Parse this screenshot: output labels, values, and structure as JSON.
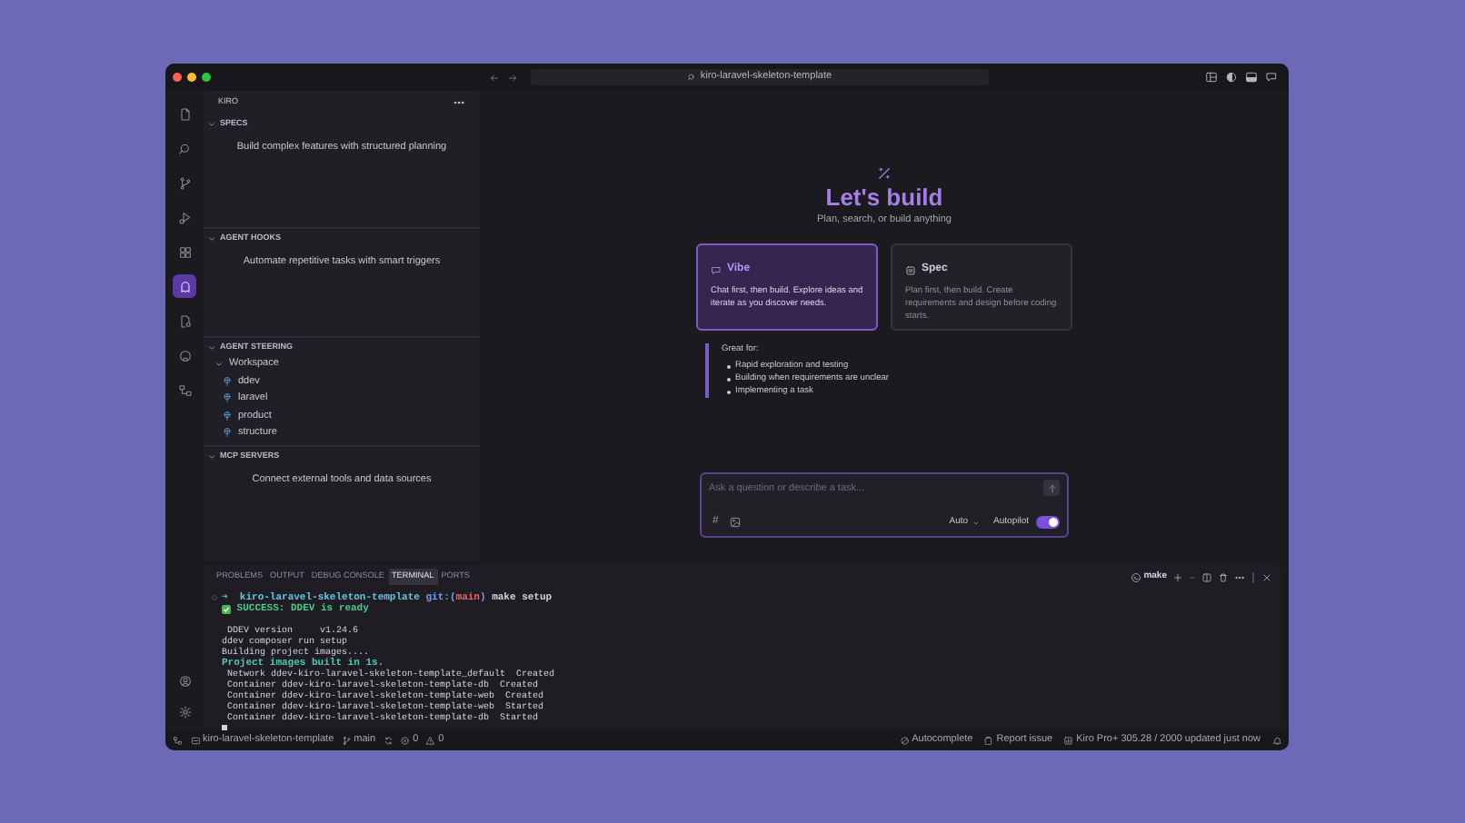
{
  "window": {
    "title": "kiro-laravel-skeleton-template"
  },
  "activity_bar": {
    "top": [
      {
        "kind": "files",
        "selected": false
      },
      {
        "kind": "search",
        "selected": false
      },
      {
        "kind": "branch",
        "selected": false
      },
      {
        "kind": "run",
        "selected": false
      },
      {
        "kind": "extensions",
        "selected": false
      },
      {
        "kind": "ghost",
        "selected": true
      },
      {
        "kind": "document",
        "selected": false
      },
      {
        "kind": "cat",
        "selected": false
      },
      {
        "kind": "remote",
        "selected": false
      }
    ],
    "bottom": [
      {
        "kind": "account"
      },
      {
        "kind": "settings"
      }
    ]
  },
  "sidebar": {
    "title": "KIRO",
    "sections": [
      {
        "title": "SPECS",
        "expanded": true,
        "description": "Build complex features with structured planning"
      },
      {
        "title": "AGENT HOOKS",
        "expanded": true,
        "description": "Automate repetitive tasks with smart triggers"
      },
      {
        "title": "AGENT STEERING",
        "expanded": true,
        "tree": [
          {
            "label": "Workspace",
            "expanded": true,
            "children": [
              {
                "label": "ddev"
              },
              {
                "label": "laravel"
              },
              {
                "label": "product"
              },
              {
                "label": "structure"
              }
            ]
          }
        ]
      },
      {
        "title": "MCP SERVERS",
        "expanded": true,
        "description": "Connect external tools and data sources"
      }
    ]
  },
  "editor": {
    "heading": "Let's build",
    "subtitle": "Plan, search, or build anything",
    "modes": [
      {
        "kind": "chat",
        "title": "Vibe",
        "description": "Chat first, then build. Explore ideas and iterate as you discover needs.",
        "selected": true
      },
      {
        "kind": "spec",
        "title": "Spec",
        "description": "Plan first, then build. Create requirements and design before coding starts.",
        "selected": false
      }
    ],
    "details": {
      "heading": "Great for:",
      "items": [
        "Rapid exploration and testing",
        "Building when requirements are unclear",
        "Implementing a task"
      ]
    },
    "chat": {
      "placeholder": "Ask a question or describe a task...",
      "hash": "#",
      "model": "Auto",
      "autopilot": {
        "label": "Autopilot",
        "on": true
      }
    }
  },
  "panel": {
    "tabs": [
      {
        "label": "PROBLEMS",
        "selected": false
      },
      {
        "label": "OUTPUT",
        "selected": false
      },
      {
        "label": "DEBUG CONSOLE",
        "selected": false
      },
      {
        "label": "TERMINAL",
        "selected": true
      },
      {
        "label": "PORTS",
        "selected": false
      }
    ],
    "terminal_name": "make",
    "lines": [
      {
        "kind": "command",
        "segments": [
          {
            "kind": "text",
            "text": "➜  ",
            "color": "#4ec98a"
          },
          {
            "kind": "text",
            "text": "kiro-laravel-skeleton-template",
            "color": "#62c8e0"
          },
          {
            "kind": "text",
            "text": " git:(",
            "color": "#6f9ef8"
          },
          {
            "kind": "text",
            "text": "main",
            "color": "#e5656f"
          },
          {
            "kind": "text",
            "text": ")",
            "color": "#6f9ef8"
          },
          {
            "kind": "text",
            "text": " make setup",
            "color": "#d4d4d4"
          }
        ]
      },
      {
        "kind": "output",
        "segments": [
          {
            "kind": "check"
          },
          {
            "kind": "text",
            "text": " SUCCESS: DDEV is ready",
            "color": "#4ec98a"
          }
        ]
      },
      {
        "kind": "output",
        "spaced": true,
        "segments": [
          {
            "kind": "text",
            "text": " DDEV version     v1.24.6"
          }
        ]
      },
      {
        "kind": "output",
        "segments": [
          {
            "kind": "text",
            "text": "ddev composer run setup"
          }
        ]
      },
      {
        "kind": "output",
        "segments": [
          {
            "kind": "text",
            "text": "Building project images...."
          }
        ]
      },
      {
        "kind": "output",
        "segments": [
          {
            "kind": "text",
            "text": "Project images built in 1s.",
            "color": "#4fc9b8"
          }
        ]
      },
      {
        "kind": "output",
        "segments": [
          {
            "kind": "text",
            "text": " Network ddev-kiro-laravel-skeleton-template_default  Created"
          }
        ]
      },
      {
        "kind": "output",
        "segments": [
          {
            "kind": "text",
            "text": " Container ddev-kiro-laravel-skeleton-template-db  Created"
          }
        ]
      },
      {
        "kind": "output",
        "segments": [
          {
            "kind": "text",
            "text": " Container ddev-kiro-laravel-skeleton-template-web  Created"
          }
        ]
      },
      {
        "kind": "output",
        "segments": [
          {
            "kind": "text",
            "text": " Container ddev-kiro-laravel-skeleton-template-web  Started"
          }
        ]
      },
      {
        "kind": "output",
        "segments": [
          {
            "kind": "text",
            "text": " Container ddev-kiro-laravel-skeleton-template-db  Started"
          }
        ]
      },
      {
        "kind": "cursor"
      }
    ]
  },
  "status_bar": {
    "left": [
      {
        "kind": "remote"
      },
      {
        "kind": "folder",
        "text": "kiro-laravel-skeleton-template"
      },
      {
        "kind": "branch",
        "text": "main"
      },
      {
        "kind": "sync"
      },
      {
        "kind": "errors",
        "text": "0"
      },
      {
        "kind": "warnings",
        "text": "0"
      }
    ],
    "right": [
      {
        "kind": "autocomplete",
        "text": "Autocomplete"
      },
      {
        "kind": "report",
        "text": "Report issue"
      },
      {
        "kind": "usage",
        "text": "Kiro Pro+ 305.28 / 2000 updated just now"
      },
      {
        "kind": "bell"
      }
    ]
  }
}
